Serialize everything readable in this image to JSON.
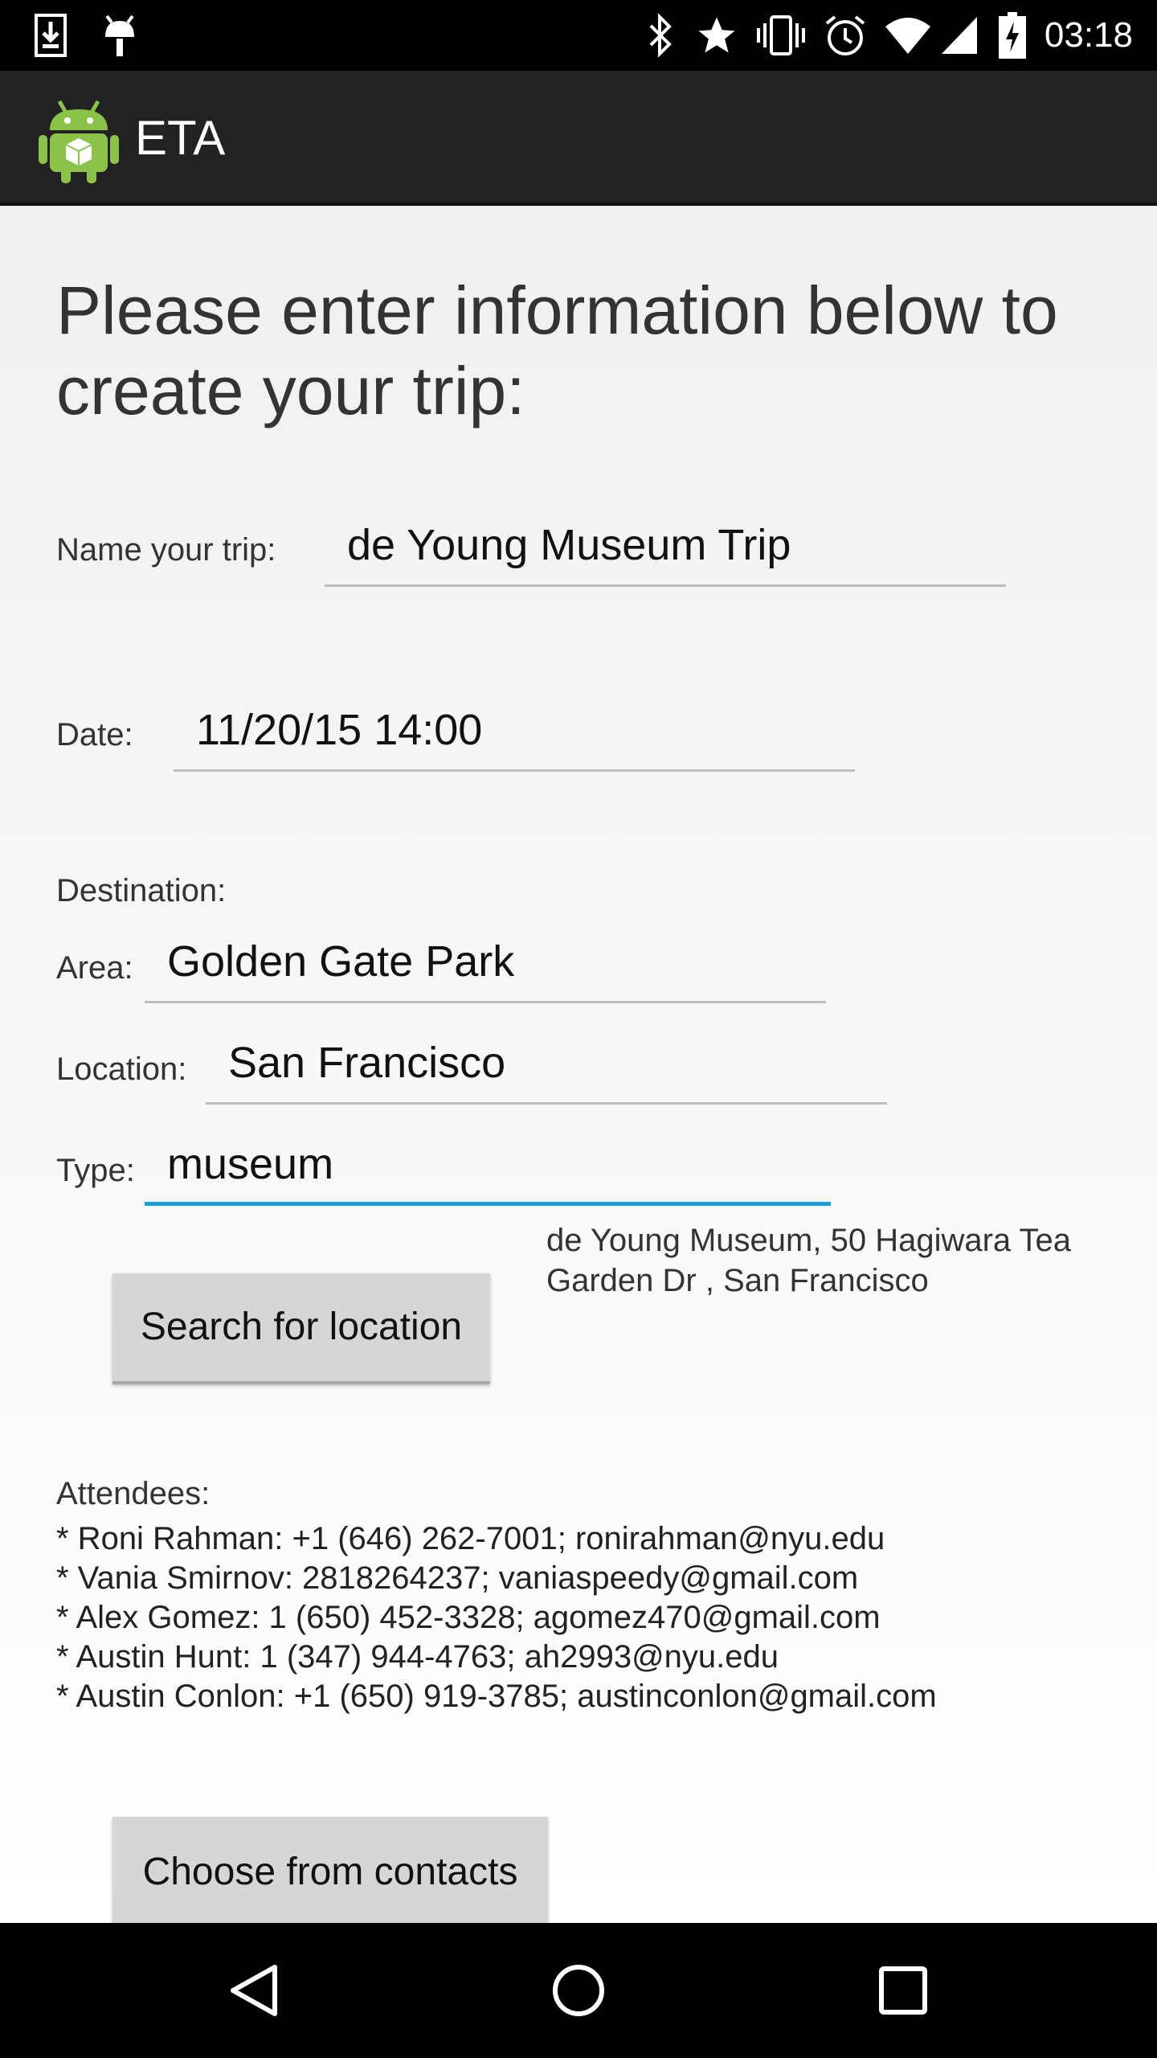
{
  "status_bar": {
    "time": "03:18",
    "icons": [
      "download-icon",
      "android-debug-icon",
      "bluetooth-icon",
      "star-icon",
      "vibrate-icon",
      "alarm-icon",
      "wifi-icon",
      "signal-icon",
      "battery-charging-icon"
    ]
  },
  "action_bar": {
    "title": "ETA",
    "icon": "android-app-icon"
  },
  "form": {
    "heading": "Please enter information below to create your trip:",
    "trip_name_label": "Name your trip:",
    "trip_name_value": "de Young Museum Trip",
    "date_label": "Date:",
    "date_value": "11/20/15 14:00",
    "destination_label": "Destination:",
    "area_label": "Area:",
    "area_value": "Golden Gate Park",
    "location_label": "Location:",
    "location_value": "San Francisco",
    "type_label": "Type:",
    "type_value": "museum",
    "search_button": "Search for location",
    "search_result": "de Young Museum, 50 Hagiwara Tea Garden Dr , San Francisco",
    "attendees_label": "Attendees:",
    "attendees": [
      "* Roni Rahman: +1 (646) 262-7001; ronirahman@nyu.edu",
      "* Vania Smirnov: 2818264237; vaniaspeedy@gmail.com",
      "* Alex Gomez: 1 (650) 452-3328; agomez470@gmail.com",
      "* Austin Hunt: 1 (347) 944-4763; ah2993@nyu.edu",
      "* Austin Conlon: +1 (650) 919-3785; austinconlon@gmail.com"
    ],
    "contacts_button": "Choose from contacts"
  },
  "nav_bar": {
    "icons": [
      "back-icon",
      "home-icon",
      "recents-icon"
    ]
  },
  "colors": {
    "accent": "#1a9dd8",
    "action_bar": "#222222",
    "android_green": "#8bc34a"
  }
}
